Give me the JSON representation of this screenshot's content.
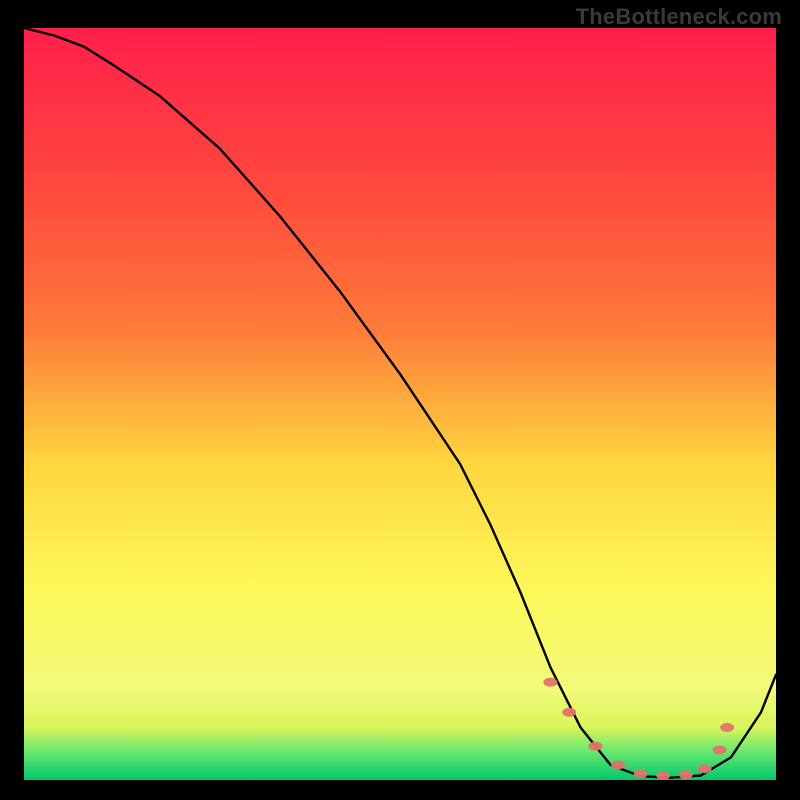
{
  "watermark": "TheBottleneck.com",
  "chart_data": {
    "type": "line",
    "title": "",
    "xlabel": "",
    "ylabel": "",
    "xlim": [
      0,
      100
    ],
    "ylim": [
      0,
      100
    ],
    "gradient_colors": {
      "top": "#ff1f4b",
      "upper_mid": "#ff7a3a",
      "mid": "#ffd640",
      "lower_mid": "#fdf95a",
      "low": "#d9f55a",
      "bottom_band_top": "#6fe86f",
      "bottom": "#00c86e"
    },
    "series": [
      {
        "name": "bottleneck-curve",
        "x": [
          0,
          4,
          8,
          12,
          18,
          26,
          34,
          42,
          50,
          58,
          62,
          66,
          70,
          74,
          78,
          82,
          86,
          90,
          94,
          98,
          100
        ],
        "y": [
          100,
          99,
          97.5,
          95,
          91,
          84,
          75,
          65,
          54,
          42,
          34,
          25,
          15,
          7,
          2,
          0.5,
          0.3,
          0.6,
          3,
          9,
          14
        ]
      }
    ],
    "markers": {
      "name": "highlight-dots",
      "color": "#e4726b",
      "x": [
        70,
        72.5,
        76,
        79,
        82,
        85,
        88,
        90.5,
        92.5,
        93.5
      ],
      "y": [
        13,
        9,
        4.5,
        2,
        0.8,
        0.6,
        0.7,
        1.5,
        4,
        7
      ]
    }
  }
}
